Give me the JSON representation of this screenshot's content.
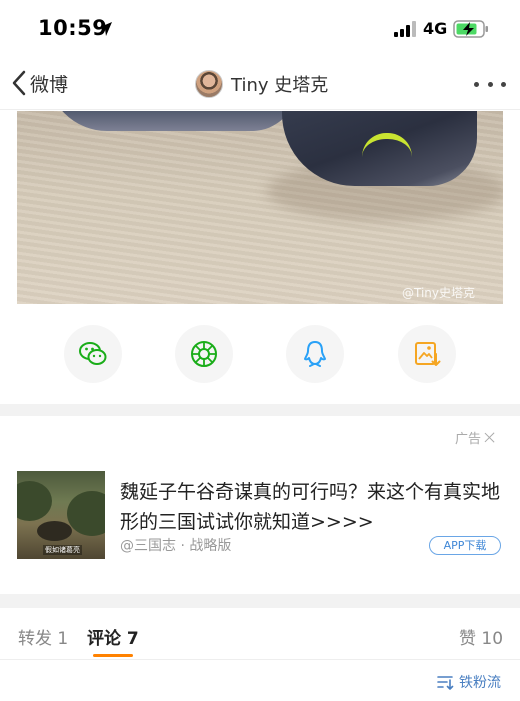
{
  "status_bar": {
    "time": "10:59",
    "network": "4G"
  },
  "nav": {
    "back_label": "微博",
    "title": "Tiny 史塔克"
  },
  "post": {
    "image_watermark": "@Tiny史塔克"
  },
  "share_icons": [
    "wechat-icon",
    "moments-icon",
    "qq-icon",
    "save-image-icon"
  ],
  "ad": {
    "tag": "广告",
    "title": "魏延子午谷奇谋真的可行吗？来这个有真实地形的三国试试你就知道>>>>",
    "source": "@三国志 · 战略版",
    "download_label": "APP下载",
    "thumb_caption": "假如诸葛亮"
  },
  "tabs": {
    "repost": "转发 1",
    "comments": "评论 7",
    "likes": "赞 10"
  },
  "sort_label": "铁粉流",
  "colors": {
    "accent": "#ff8200",
    "link_blue": "#4a7fc1",
    "wechat_green": "#1aad19",
    "qq_blue": "#29a1f7",
    "save_orange": "#f5a623"
  }
}
